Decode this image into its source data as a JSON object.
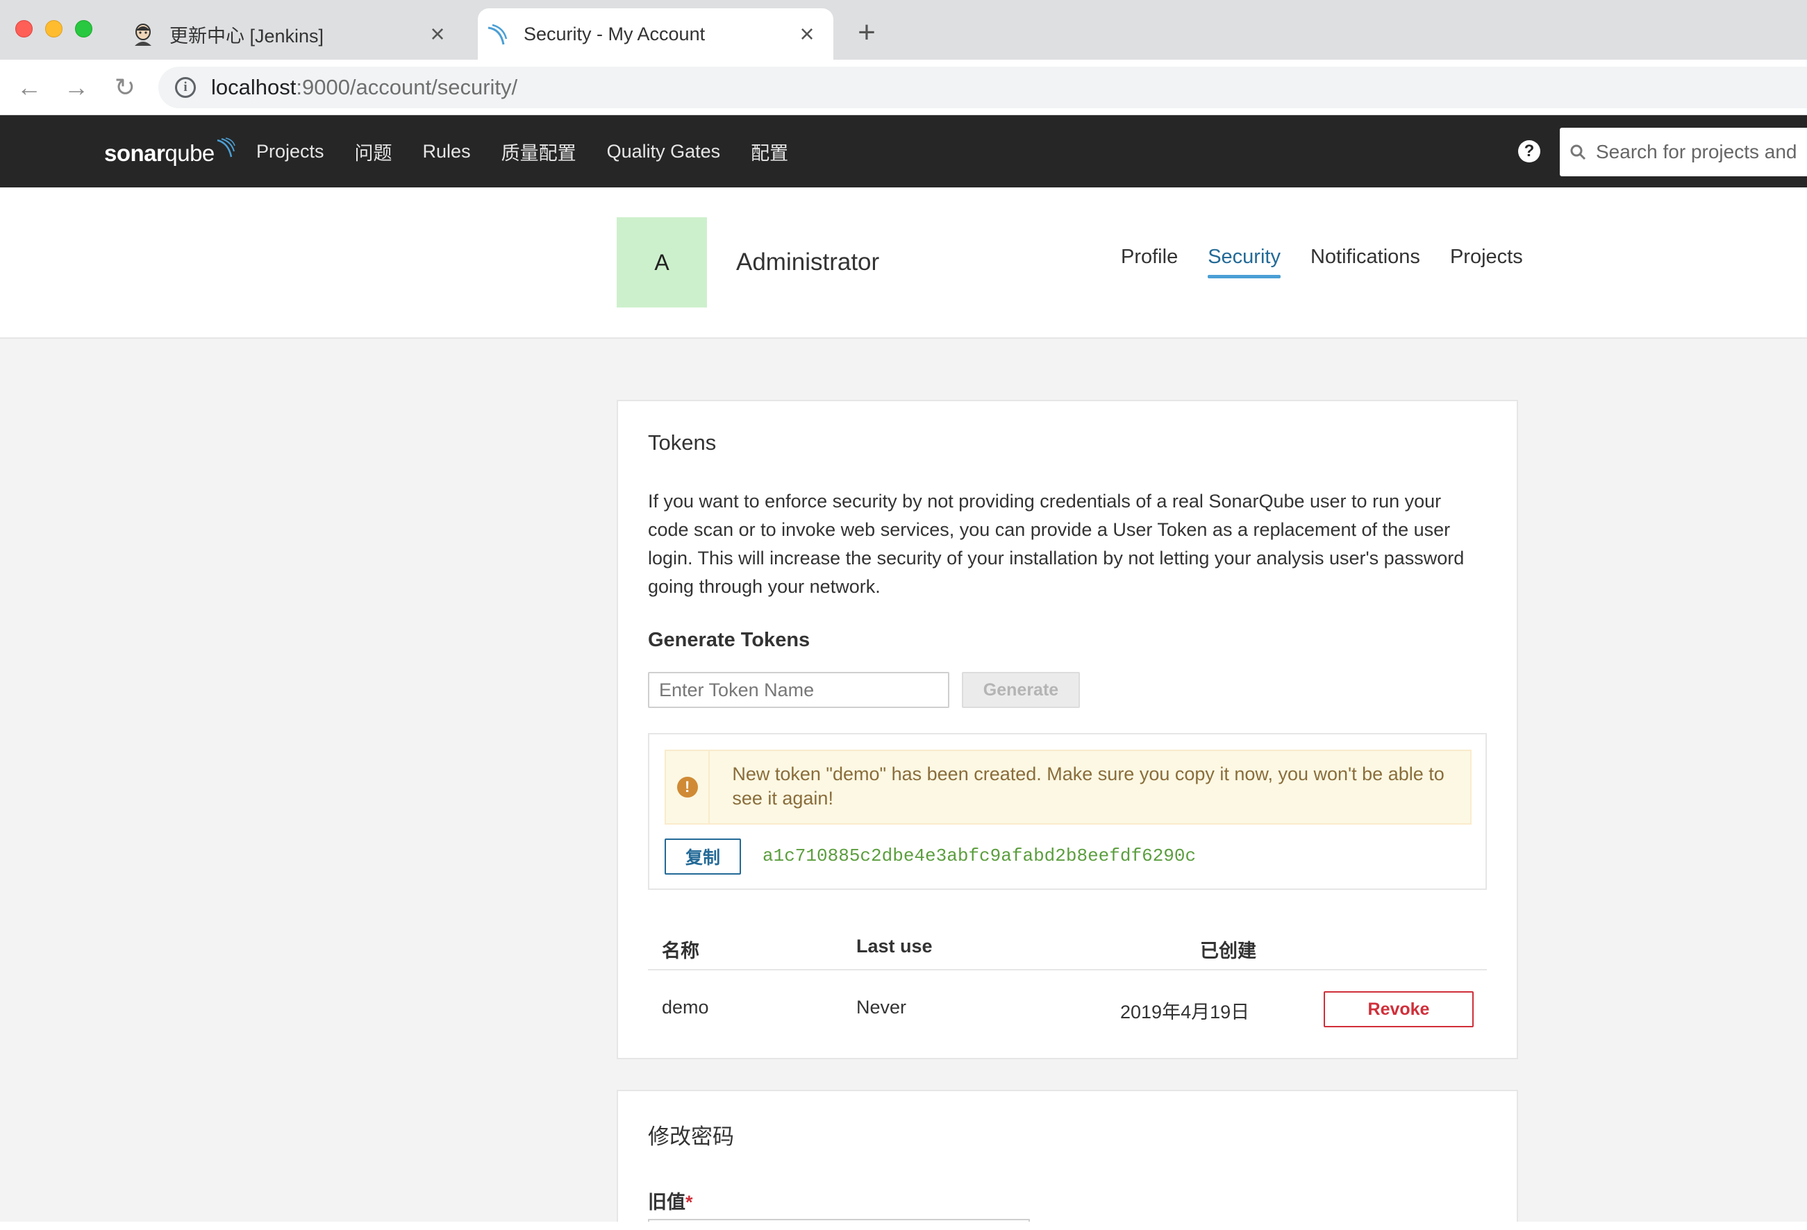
{
  "browser": {
    "tabs": [
      {
        "title": "更新中心 [Jenkins]",
        "active": false,
        "favicon": "jenkins-icon"
      },
      {
        "title": "Security - My Account",
        "active": true,
        "favicon": "sonarqube-icon"
      }
    ],
    "url_host": "localhost",
    "url_path": ":9000/account/security/"
  },
  "nav": {
    "logo_text_bold": "sonar",
    "logo_text": "qube",
    "items": [
      "Projects",
      "问题",
      "Rules",
      "质量配置",
      "Quality Gates",
      "配置"
    ],
    "help_glyph": "?",
    "search_placeholder": "Search for projects and"
  },
  "account": {
    "avatar_letter": "A",
    "name": "Administrator",
    "tabs": [
      {
        "label": "Profile",
        "active": false
      },
      {
        "label": "Security",
        "active": true
      },
      {
        "label": "Notifications",
        "active": false
      },
      {
        "label": "Projects",
        "active": false
      }
    ]
  },
  "tokens": {
    "title": "Tokens",
    "description": "If you want to enforce security by not providing credentials of a real SonarQube user to run your code scan or to invoke web services, you can provide a User Token as a replacement of the user login. This will increase the security of your installation by not letting your analysis user's password going through your network.",
    "generate_title": "Generate Tokens",
    "input_placeholder": "Enter Token Name",
    "generate_label": "Generate",
    "alert_icon": "!",
    "alert_text": "New token \"demo\" has been created. Make sure you copy it now, you won't be able to see it again!",
    "copy_label": "复制",
    "token_value": "a1c710885c2dbe4e3abfc9afabd2b8eefdf6290c",
    "table": {
      "headers": {
        "name": "名称",
        "last_use": "Last use",
        "created": "已创建"
      },
      "rows": [
        {
          "name": "demo",
          "last_use": "Never",
          "created": "2019年4月19日",
          "action": "Revoke"
        }
      ]
    }
  },
  "password": {
    "title": "修改密码",
    "old_label": "旧值",
    "required_mark": "*"
  },
  "colors": {
    "nav_bg": "#262626",
    "accent": "#236a97",
    "danger": "#d02f3a",
    "token_green": "#5b9e3e",
    "alert_bg": "#fcf8e3"
  }
}
